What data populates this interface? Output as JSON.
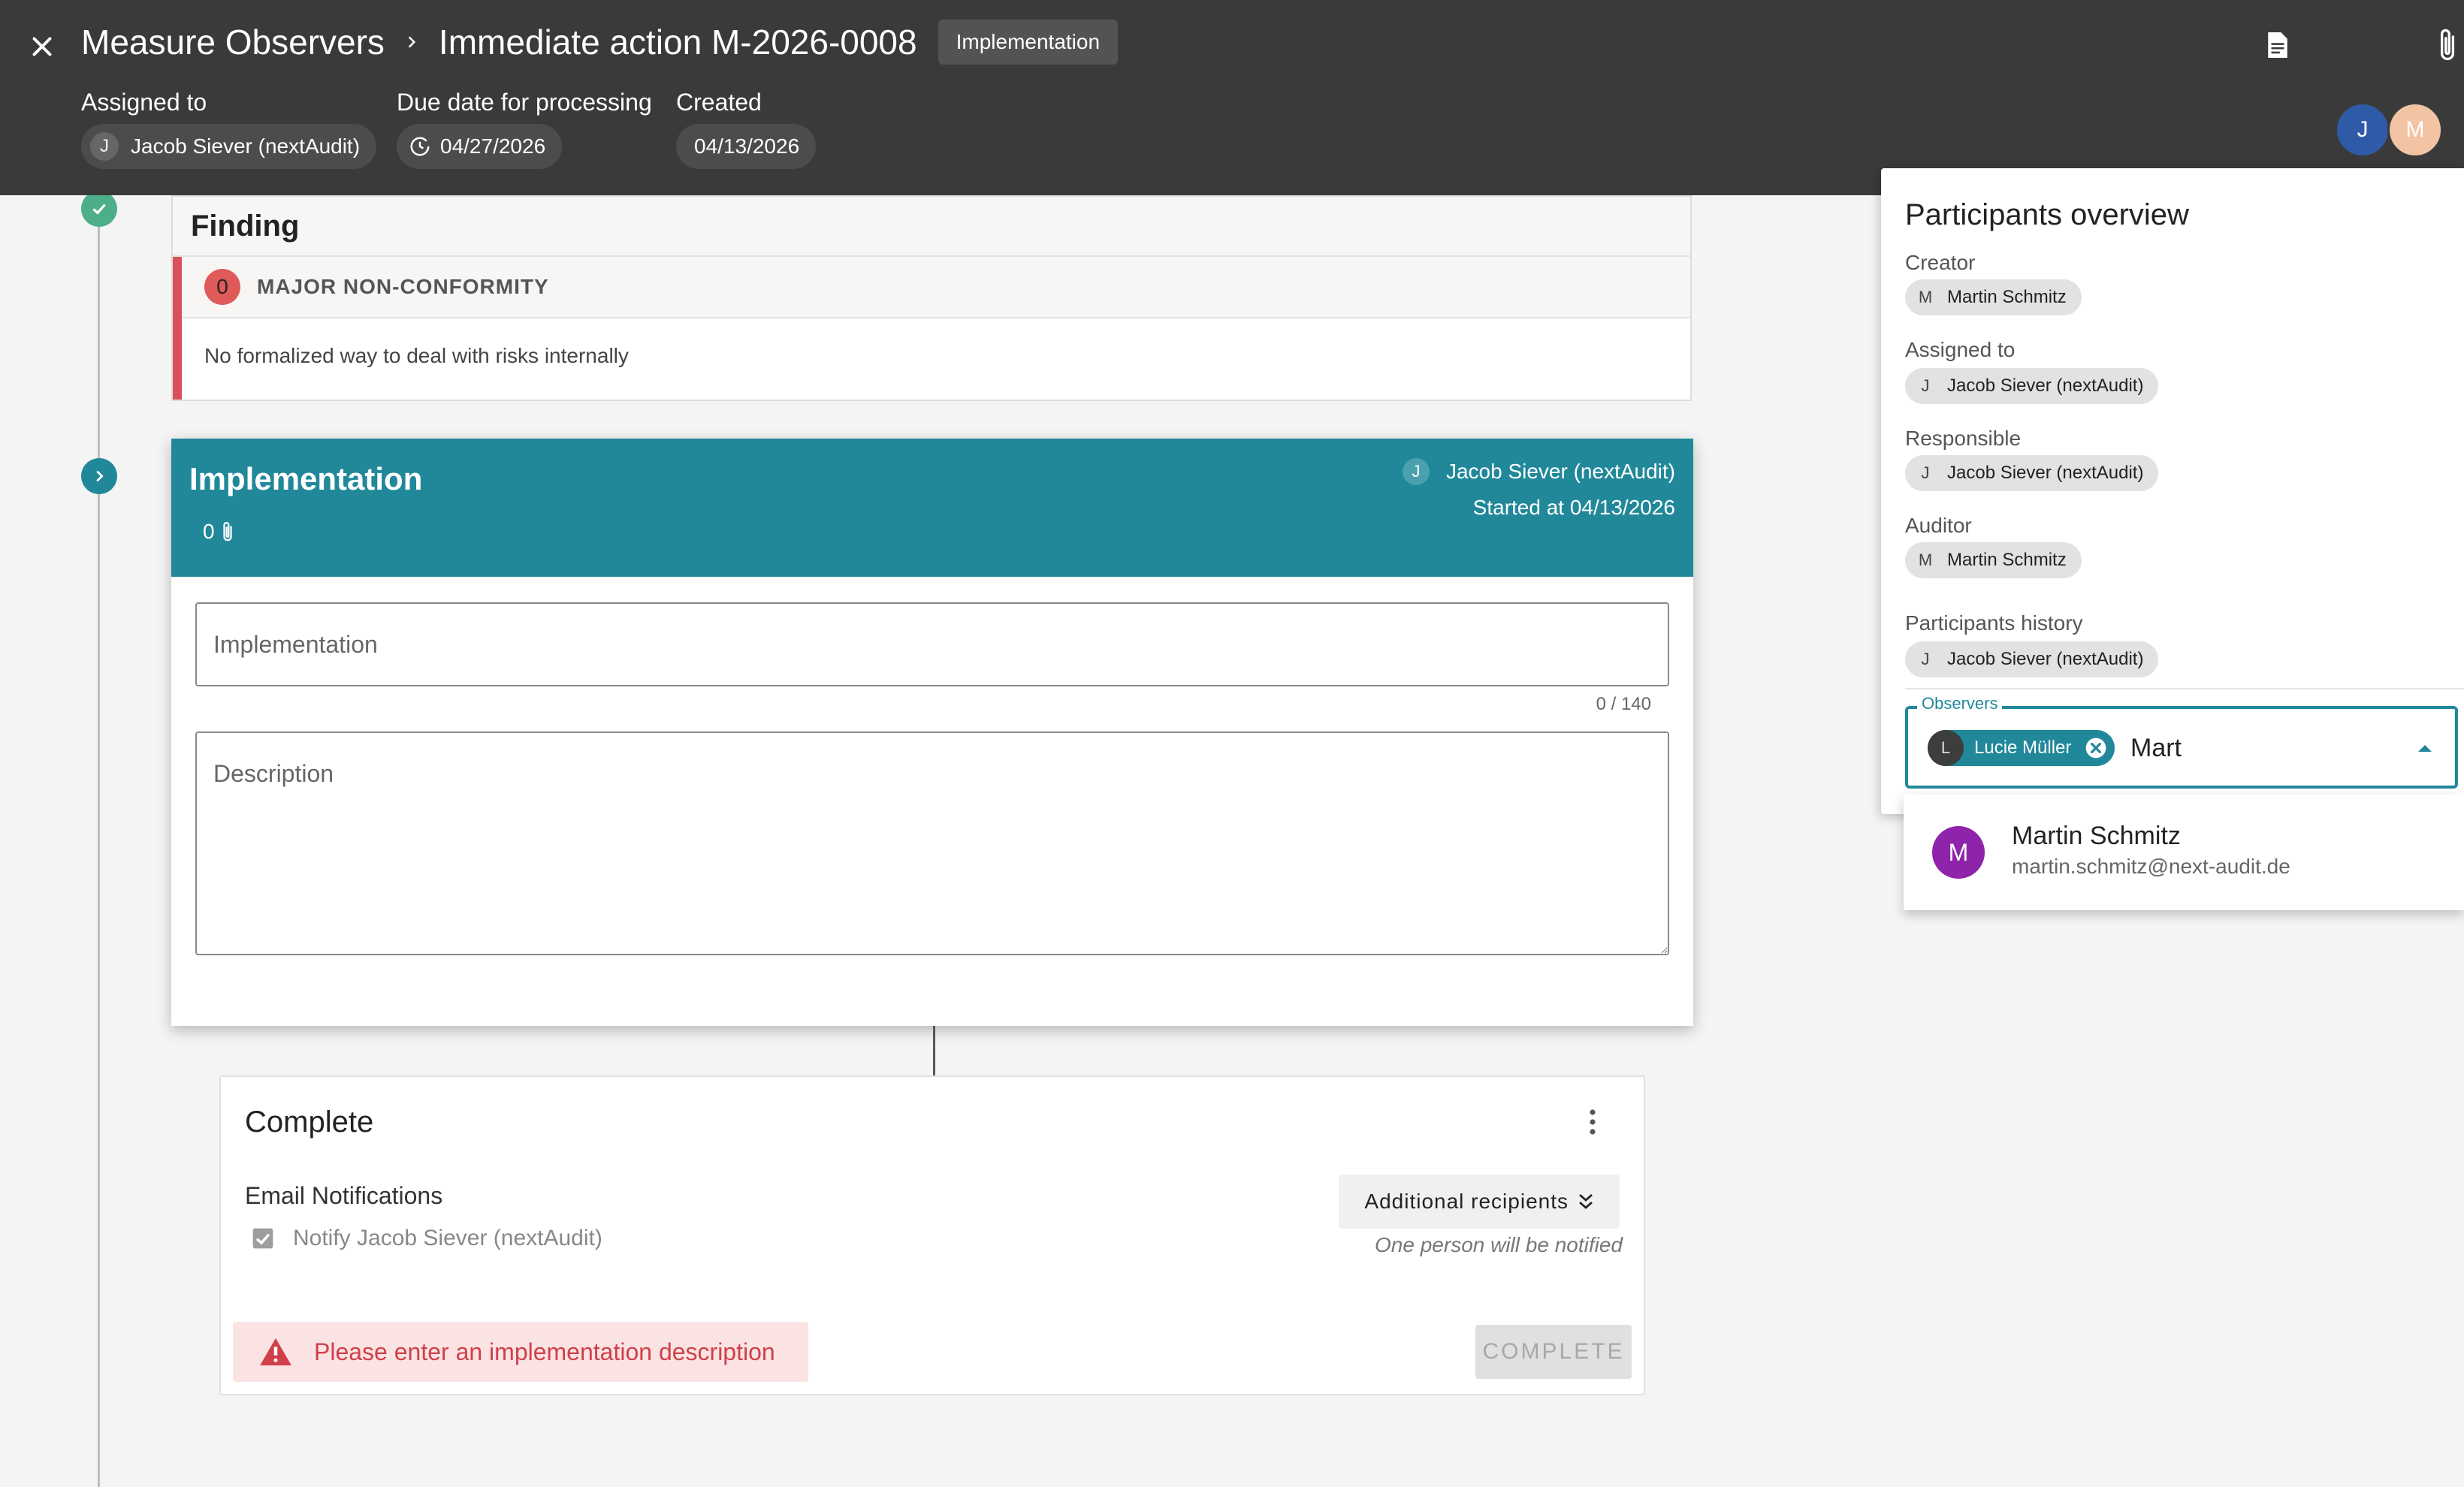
{
  "header": {
    "breadcrumb_parent": "Measure Observers",
    "title": "Immediate action M-2026-0008",
    "status": "Implementation",
    "assigned_label": "Assigned to",
    "assigned_initial": "J",
    "assigned_value": "Jacob Siever (nextAudit)",
    "due_label": "Due date for processing",
    "due_value": "04/27/2026",
    "created_label": "Created",
    "created_value": "04/13/2026",
    "avatars": [
      {
        "initial": "J",
        "color": "#2f5aa8"
      },
      {
        "initial": "M",
        "color": "#f2c4a4"
      }
    ]
  },
  "finding": {
    "title": "Finding",
    "nc_count": "0",
    "nc_label": "MAJOR NON-CONFORMITY",
    "text": "No formalized way to deal with risks internally"
  },
  "implementation": {
    "title": "Implementation",
    "attachments": "0",
    "user_initial": "J",
    "user": "Jacob Siever (nextAudit)",
    "started": "Started at 04/13/2026",
    "field_placeholder": "Implementation",
    "counter": "0 / 140",
    "description_placeholder": "Description"
  },
  "complete": {
    "title": "Complete",
    "email_label": "Email Notifications",
    "notify_label": "Notify Jacob Siever (nextAudit)",
    "additional_label": "Additional recipients",
    "notified_note": "One person will be notified",
    "warning": "Please enter an implementation description",
    "button": "COMPLETE"
  },
  "participants": {
    "title": "Participants overview",
    "creator_label": "Creator",
    "creator_initial": "M",
    "creator": "Martin Schmitz",
    "assigned_label": "Assigned to",
    "assigned_initial": "J",
    "assigned": "Jacob Siever (nextAudit)",
    "responsible_label": "Responsible",
    "responsible_initial": "J",
    "responsible": "Jacob Siever (nextAudit)",
    "auditor_label": "Auditor",
    "auditor_initial": "M",
    "auditor": "Martin Schmitz",
    "history_label": "Participants history",
    "history_initial": "J",
    "history": "Jacob Siever (nextAudit)",
    "observers_label": "Observers",
    "observer_initial": "L",
    "observer_chip": "Lucie Müller",
    "observer_query": "Mart"
  },
  "suggestion": {
    "initial": "M",
    "name": "Martin Schmitz",
    "email": "martin.schmitz@next-audit.de"
  },
  "colors": {
    "header_bg": "#3a3a3a",
    "accent_teal": "#21889a",
    "error_red": "#d9505b",
    "done_green": "#4caf8a"
  }
}
